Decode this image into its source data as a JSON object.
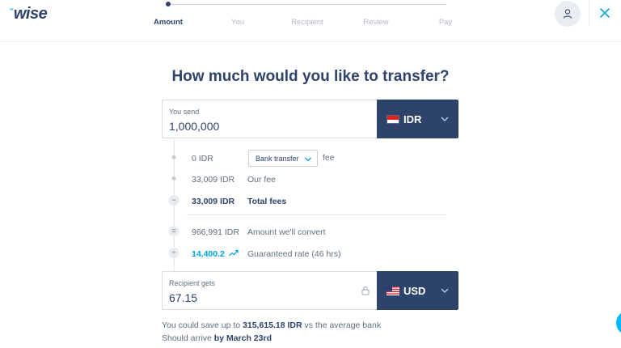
{
  "header": {
    "logo_text": "wise",
    "steps": [
      {
        "label": "Amount",
        "active": true
      },
      {
        "label": "You",
        "active": false
      },
      {
        "label": "Recipient",
        "active": false
      },
      {
        "label": "Review",
        "active": false
      },
      {
        "label": "Pay",
        "active": false
      }
    ],
    "profile_icon": "user-icon",
    "close_icon": "close-icon"
  },
  "main": {
    "title": "How much would you like to transfer?",
    "send": {
      "label": "You send",
      "value": "1,000,000",
      "currency": "IDR",
      "flag": "indonesia-flag-icon"
    },
    "breakdown": {
      "transfer_fee_amount": "0 IDR",
      "payment_method": "Bank transfer",
      "fee_word": "fee",
      "our_fee_amount": "33,009 IDR",
      "our_fee_label": "Our fee",
      "total_fees_amount": "33,009 IDR",
      "total_fees_label": "Total fees",
      "convert_amount": "966,991 IDR",
      "convert_label": "Amount we'll convert",
      "rate_value": "14,400.2",
      "rate_label": "Guaranteed rate (46 hrs)",
      "minus_symbol": "−",
      "equals_symbol": "=",
      "divide_symbol": "÷"
    },
    "receive": {
      "label": "Recipient gets",
      "value": "67.15",
      "currency": "USD",
      "flag": "usa-flag-icon"
    },
    "savings": {
      "prefix": "You could save up to",
      "amount": "315,615.18 IDR",
      "suffix": "vs the average bank"
    },
    "arrival": {
      "prefix": "Should arrive",
      "date": "by March 23rd"
    }
  },
  "colors": {
    "navy": "#2e4369",
    "accent_blue": "#00b9ff",
    "rate_blue": "#00a2dd",
    "text_gray": "#5d7079"
  }
}
